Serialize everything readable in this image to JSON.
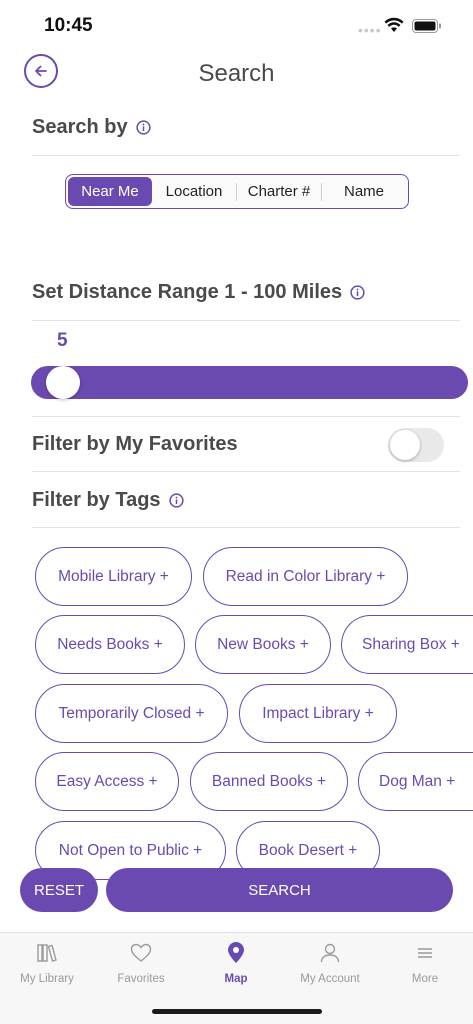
{
  "status_bar": {
    "time": "10:45"
  },
  "header": {
    "title": "Search"
  },
  "search_by": {
    "label": "Search by",
    "options": [
      "Near Me",
      "Location",
      "Charter #",
      "Name"
    ],
    "selected": "Near Me"
  },
  "distance": {
    "label": "Set Distance Range 1 - 100 Miles",
    "value": "5",
    "min": 1,
    "max": 100
  },
  "favorites": {
    "label": "Filter by My Favorites",
    "enabled": false
  },
  "tags": {
    "label": "Filter by Tags",
    "items": [
      "Mobile Library +",
      "Read in Color Library +",
      "Needs Books +",
      "New Books +",
      "Sharing Box +",
      "Temporarily Closed +",
      "Impact Library +",
      "Easy Access +",
      "Banned Books +",
      "Dog Man +",
      "Not Open to Public +",
      "Book Desert +"
    ]
  },
  "actions": {
    "reset": "RESET",
    "search": "SEARCH"
  },
  "tab_bar": {
    "items": [
      {
        "label": "My Library",
        "icon": "books-icon"
      },
      {
        "label": "Favorites",
        "icon": "heart-icon"
      },
      {
        "label": "Map",
        "icon": "map-pin-icon"
      },
      {
        "label": "My Account",
        "icon": "person-icon"
      },
      {
        "label": "More",
        "icon": "menu-icon"
      }
    ],
    "active": "Map"
  },
  "colors": {
    "accent": "#6a4ab0",
    "text": "#4a4a4a",
    "inactive": "#9a9a9a"
  }
}
